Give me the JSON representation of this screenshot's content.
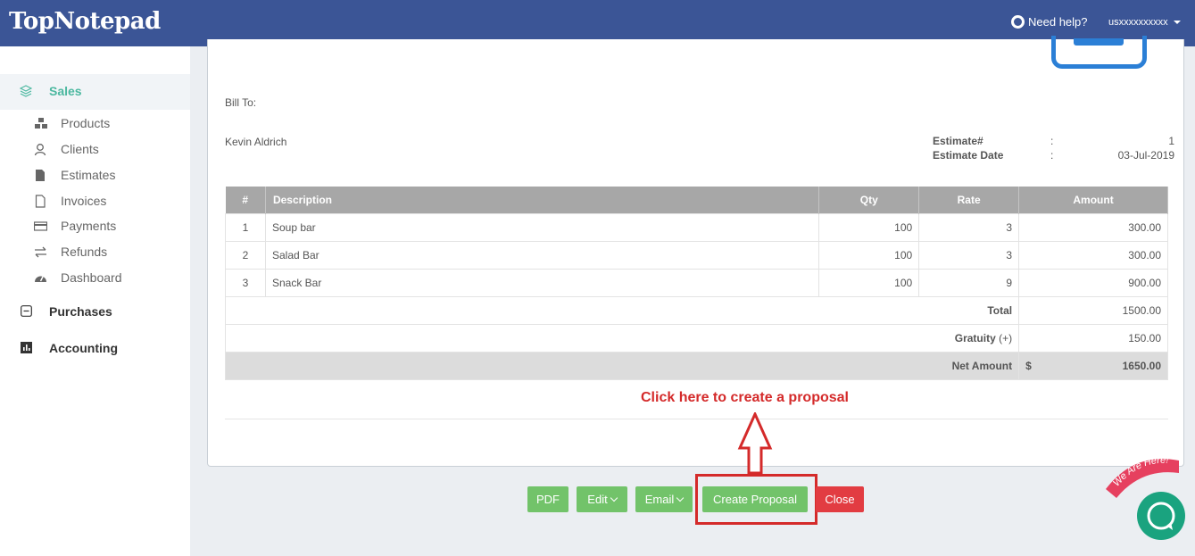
{
  "header": {
    "logo": "TopNotepad",
    "help_label": "Need help?",
    "user_label": "usxxxxxxxxxx"
  },
  "sidebar": {
    "sales_label": "Sales",
    "items": [
      {
        "label": "Products",
        "icon": "cubes-icon"
      },
      {
        "label": "Clients",
        "icon": "user-icon"
      },
      {
        "label": "Estimates",
        "icon": "file-icon"
      },
      {
        "label": "Invoices",
        "icon": "file-outline-icon"
      },
      {
        "label": "Payments",
        "icon": "credit-card-icon"
      },
      {
        "label": "Refunds",
        "icon": "exchange-icon"
      },
      {
        "label": "Dashboard",
        "icon": "dashboard-icon"
      }
    ],
    "purchases_label": "Purchases",
    "accounting_label": "Accounting"
  },
  "estimate": {
    "bill_to_label": "Bill To:",
    "client_name": "Kevin Aldrich",
    "estimate_no_label": "Estimate#",
    "estimate_no": "1",
    "estimate_date_label": "Estimate Date",
    "estimate_date": "03-Jul-2019",
    "colon": ":",
    "columns": {
      "num": "#",
      "description": "Description",
      "qty": "Qty",
      "rate": "Rate",
      "amount": "Amount"
    },
    "rows": [
      {
        "num": "1",
        "description": "Soup bar",
        "qty": "100",
        "rate": "3",
        "amount": "300.00"
      },
      {
        "num": "2",
        "description": "Salad Bar",
        "qty": "100",
        "rate": "3",
        "amount": "300.00"
      },
      {
        "num": "3",
        "description": "Snack Bar",
        "qty": "100",
        "rate": "9",
        "amount": "900.00"
      }
    ],
    "total_label": "Total",
    "total": "1500.00",
    "gratuity_label": "Gratuity",
    "gratuity_sign": "(+)",
    "gratuity": "150.00",
    "net_label": "Net Amount",
    "currency": "$",
    "net": "1650.00"
  },
  "callout": "Click here to create a proposal",
  "buttons": {
    "pdf": "PDF",
    "edit": "Edit",
    "email": "Email",
    "create_proposal": "Create Proposal",
    "close": "Close"
  },
  "chat": {
    "badge": "We Are Here!"
  },
  "colors": {
    "header": "#3b5596",
    "accent": "#4cb8a0",
    "button_green": "#72c36a",
    "button_red": "#e23c42",
    "annotation_red": "#d42a2a"
  }
}
